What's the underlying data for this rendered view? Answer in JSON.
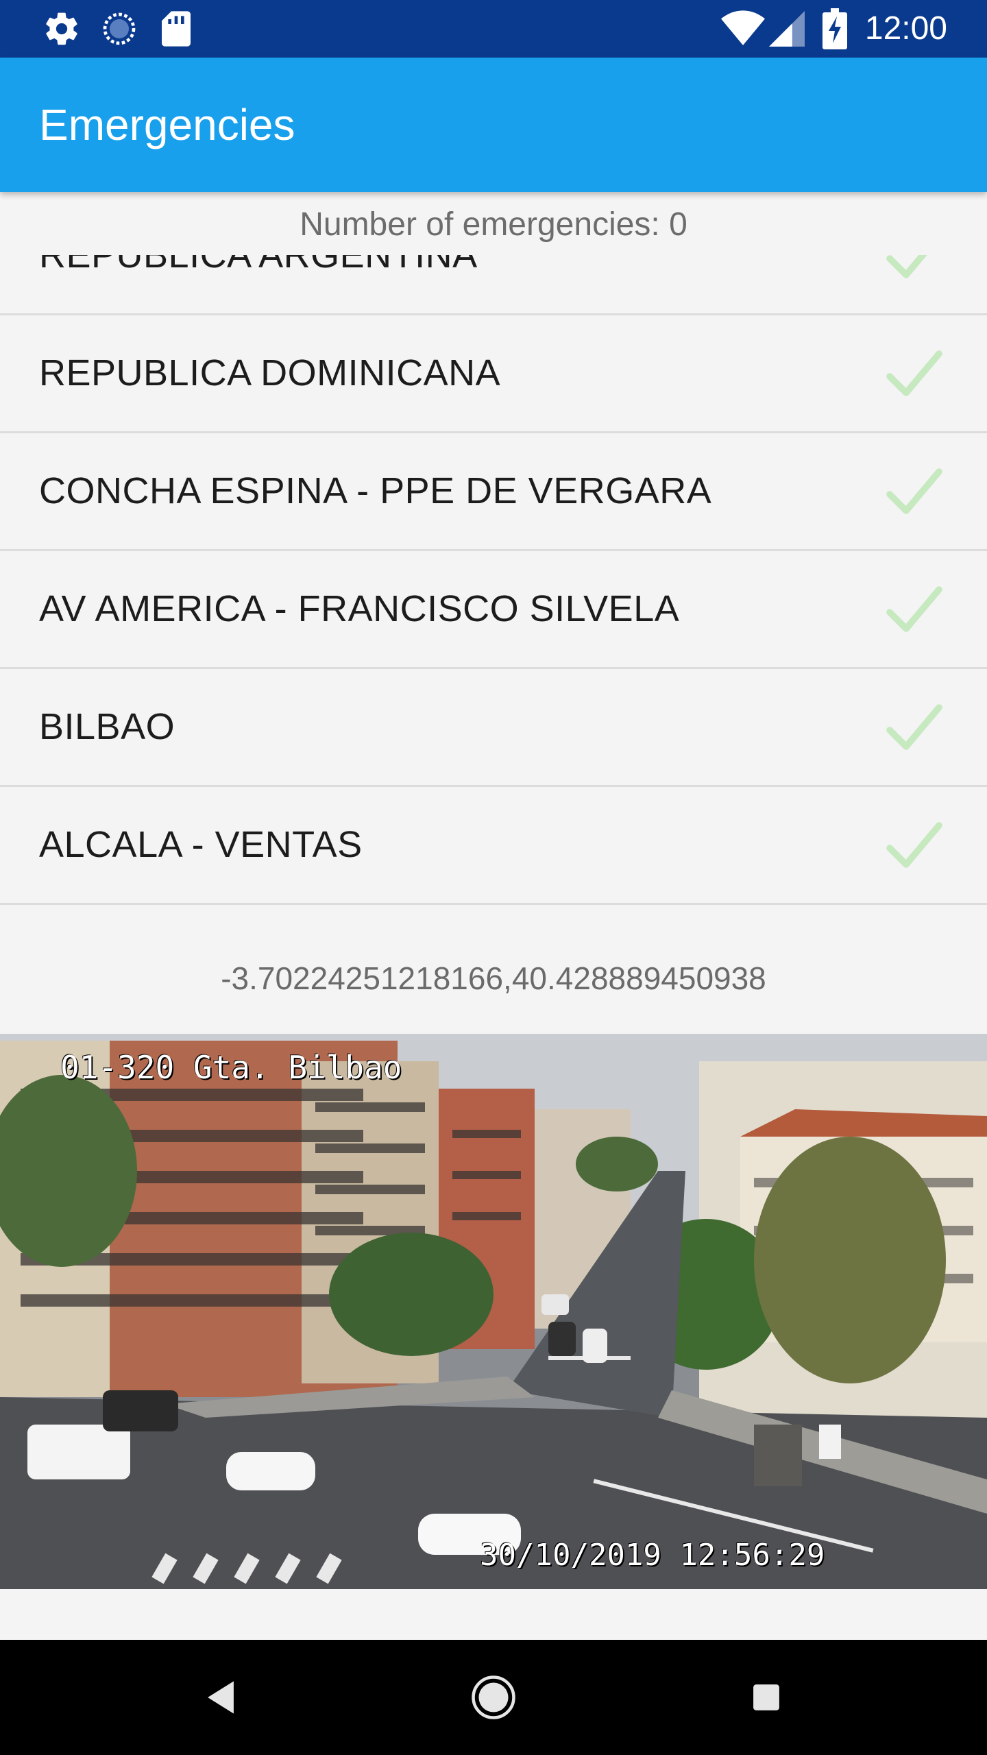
{
  "status_bar": {
    "time": "12:00",
    "icons": [
      "gear-icon",
      "sync-icon",
      "sd-card-icon",
      "wifi-icon",
      "signal-icon",
      "battery-charging-icon"
    ]
  },
  "app_bar": {
    "title": "Emergencies"
  },
  "summary": {
    "count_text": "Number of emergencies: 0"
  },
  "list": {
    "items": [
      {
        "label": "REPUBLICA ARGENTINA",
        "icon": "check-icon"
      },
      {
        "label": "REPUBLICA DOMINICANA",
        "icon": "check-icon"
      },
      {
        "label": "CONCHA ESPINA - PPE DE VERGARA",
        "icon": "check-icon"
      },
      {
        "label": "AV AMERICA - FRANCISCO SILVELA",
        "icon": "check-icon"
      },
      {
        "label": "BILBAO",
        "icon": "check-icon"
      },
      {
        "label": "ALCALA - VENTAS",
        "icon": "check-icon"
      }
    ]
  },
  "location": {
    "coordinates": "-3.70224251218166,40.428889450938"
  },
  "camera": {
    "overlay_title": "01-320 Gta. Bilbao",
    "overlay_timestamp": "30/10/2019 12:56:29"
  },
  "nav_bar": {
    "icons": [
      "back-icon",
      "home-icon",
      "recents-icon"
    ]
  },
  "colors": {
    "status_bar": "#0a3a8e",
    "app_bar": "#18a0ec",
    "check": "#c6e9bf"
  }
}
